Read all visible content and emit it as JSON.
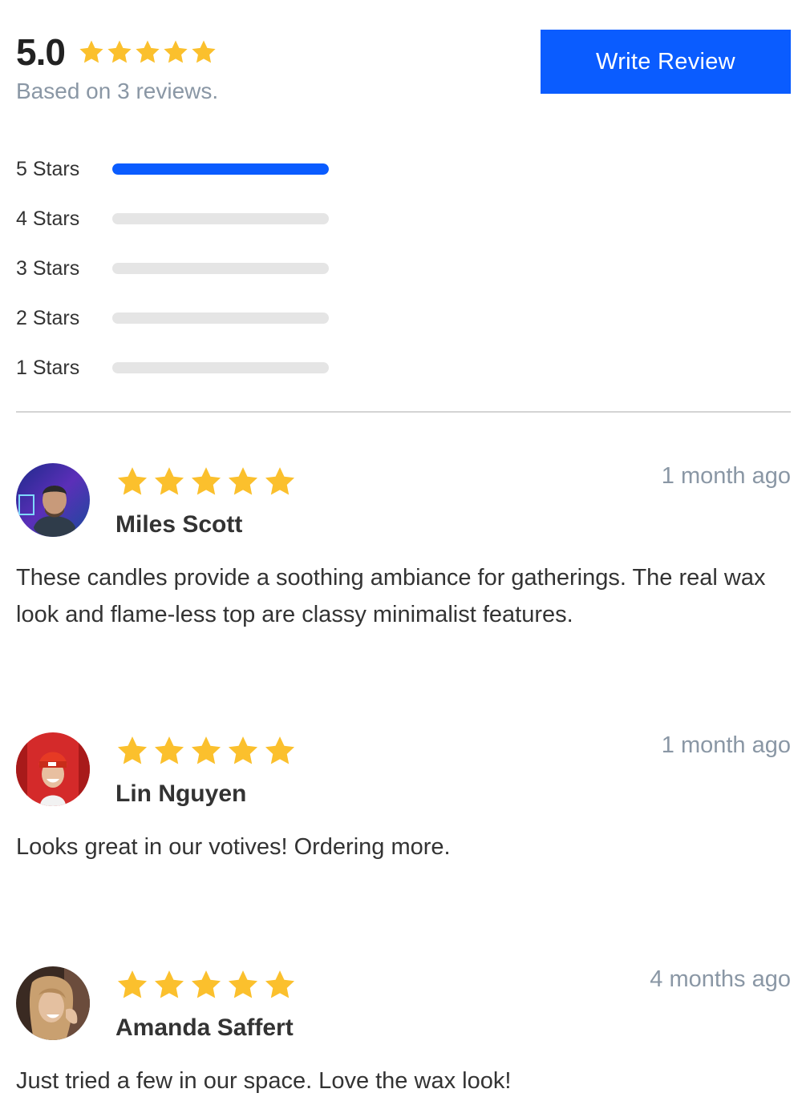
{
  "summary": {
    "average": "5.0",
    "rating": 5,
    "based_on": "Based on 3 reviews."
  },
  "write_review_label": "Write Review",
  "histogram": [
    {
      "label": "5 Stars",
      "fraction": 1.0
    },
    {
      "label": "4 Stars",
      "fraction": 0
    },
    {
      "label": "3 Stars",
      "fraction": 0
    },
    {
      "label": "2 Stars",
      "fraction": 0
    },
    {
      "label": "1 Stars",
      "fraction": 0
    }
  ],
  "reviews": [
    {
      "name": "Miles Scott",
      "time": "1 month ago",
      "rating": 5,
      "text": "These candles provide a soothing ambiance for gatherings. The real wax look and flame-less top are classy minimalist features."
    },
    {
      "name": "Lin Nguyen",
      "time": "1 month ago",
      "rating": 5,
      "text": "Looks great in our votives! Ordering more."
    },
    {
      "name": "Amanda Saffert",
      "time": "4 months ago",
      "rating": 5,
      "text": "Just tried a few in our space. Love the wax look!"
    }
  ],
  "colors": {
    "accent": "#0a5cff",
    "star": "#fbc02d",
    "muted_text": "#8a97a5",
    "bar_track": "#e5e5e5"
  },
  "icons": {
    "star": "star-icon"
  }
}
